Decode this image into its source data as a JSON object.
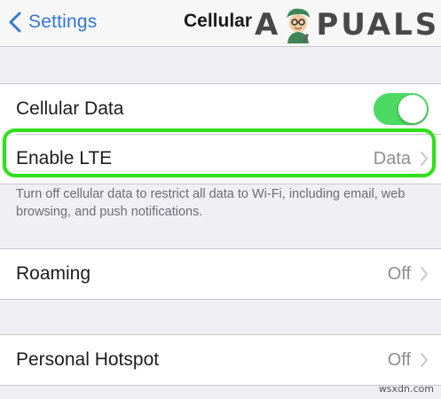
{
  "navbar": {
    "back_label": "Settings",
    "title": "Cellular"
  },
  "logo": {
    "text": "APPUALS",
    "icon": "mascot-icon"
  },
  "cellular_data": {
    "label": "Cellular Data",
    "toggle_on": true
  },
  "enable_lte": {
    "label": "Enable LTE",
    "value": "Data"
  },
  "footer_note": "Turn off cellular data to restrict all data to Wi-Fi, including email, web browsing, and push notifications.",
  "roaming": {
    "label": "Roaming",
    "value": "Off"
  },
  "personal_hotspot": {
    "label": "Personal Hotspot",
    "value": "Off"
  },
  "watermark": "wsxdn.com",
  "colors": {
    "accent": "#3478d5",
    "toggle_on": "#4cd964",
    "highlight": "#2fe01c",
    "secondary_text": "#8e8e93"
  }
}
